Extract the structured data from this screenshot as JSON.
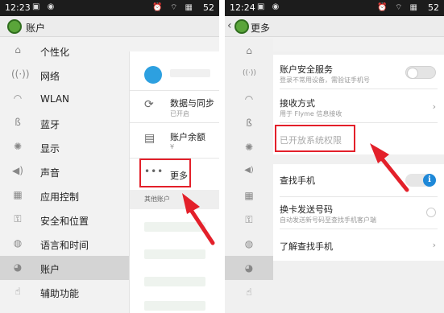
{
  "screen1": {
    "status": {
      "time": "12:23",
      "battery": "52"
    },
    "title": "账户",
    "nav": [
      {
        "icon": "personalize-icon",
        "label": "个性化"
      },
      {
        "icon": "network-icon",
        "label": "网络"
      },
      {
        "icon": "wifi-icon",
        "label": "WLAN"
      },
      {
        "icon": "bluetooth-icon",
        "label": "蓝牙"
      },
      {
        "icon": "brightness-icon",
        "label": "显示"
      },
      {
        "icon": "volume-icon",
        "label": "声音"
      },
      {
        "icon": "apps-icon",
        "label": "应用控制"
      },
      {
        "icon": "lock-icon",
        "label": "安全和位置"
      },
      {
        "icon": "globe-icon",
        "label": "语言和时间"
      },
      {
        "icon": "account-icon",
        "label": "账户"
      },
      {
        "icon": "hand-icon",
        "label": "辅助功能"
      }
    ],
    "panel": {
      "sync": {
        "title": "数据与同步",
        "subtitle": "已开启"
      },
      "balance": {
        "title": "账户余额",
        "subtitle": "¥"
      },
      "more": {
        "label": "更多"
      },
      "other_accounts": "其他账户"
    }
  },
  "screen2": {
    "status": {
      "time": "12:24",
      "battery": "52"
    },
    "title": "更多",
    "items": {
      "security_service": {
        "title": "账户安全服务",
        "subtitle": "登录不常用设备，需验证手机号"
      },
      "receive_method": {
        "title": "接收方式",
        "subtitle": "用于 Flyme 信息接收"
      },
      "opened_permissions": "已开放系统权限",
      "find_phone": {
        "title": "查找手机"
      },
      "sim_change": {
        "title": "换卡发送号码",
        "subtitle": "自动发送新号码至查找手机客户端"
      },
      "learn_find": {
        "title": "了解查找手机"
      }
    }
  },
  "colors": {
    "highlight": "#e3202a",
    "accent": "#1e88d8",
    "sync_cloud": "#2da0e0"
  }
}
